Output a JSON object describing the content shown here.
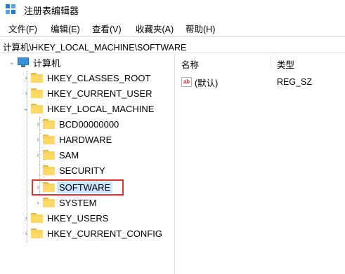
{
  "window": {
    "title": "注册表编辑器"
  },
  "menu": [
    "文件(F)",
    "编辑(E)",
    "查看(V)",
    "收藏夹(A)",
    "帮助(H)"
  ],
  "address": "计算机\\HKEY_LOCAL_MACHINE\\SOFTWARE",
  "tree": {
    "root": "计算机",
    "hives": [
      "HKEY_CLASSES_ROOT",
      "HKEY_CURRENT_USER",
      "HKEY_LOCAL_MACHINE",
      "HKEY_USERS",
      "HKEY_CURRENT_CONFIG"
    ],
    "hklm_children": [
      "BCD00000000",
      "HARDWARE",
      "SAM",
      "SECURITY",
      "SOFTWARE",
      "SYSTEM"
    ],
    "selected": "SOFTWARE"
  },
  "list": {
    "columns": [
      "名称",
      "类型"
    ],
    "rows": [
      {
        "name": "(默认)",
        "type": "REG_SZ",
        "icon": "string-value-icon"
      }
    ]
  },
  "icons": {
    "app": "regedit-icon",
    "computer": "computer-icon",
    "folder": "folder-icon",
    "expand": "chevron-right-icon",
    "collapse": "chevron-down-icon"
  },
  "colors": {
    "selection": "#cce8ff",
    "highlight_box": "#e0332b",
    "folder": "#ffd966"
  }
}
